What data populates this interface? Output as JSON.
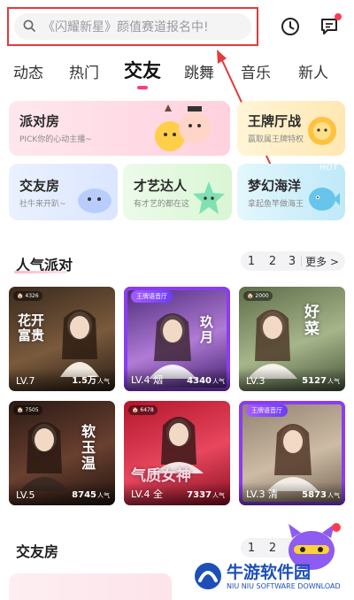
{
  "search": {
    "placeholder": "《闪耀新星》颜值赛道报名中!"
  },
  "top_icons": {
    "history": "clock-icon",
    "messages": "message-icon"
  },
  "tabs": [
    {
      "label": "动态"
    },
    {
      "label": "热门"
    },
    {
      "label": "交友",
      "active": true
    },
    {
      "label": "跳舞"
    },
    {
      "label": "音乐"
    },
    {
      "label": "新人"
    }
  ],
  "feature_cards": [
    {
      "title": "派对房",
      "subtitle": "PICK你的心动主播~"
    },
    {
      "title": "王牌厅战",
      "subtitle": "赢取属王牌特权"
    },
    {
      "title": "交友房",
      "subtitle": "社牛来开趴~"
    },
    {
      "title": "才艺达人",
      "subtitle": "有才艺的都在这"
    },
    {
      "title": "梦幻海洋",
      "subtitle": "拿起鱼竿做海王",
      "badge": "HOT"
    }
  ],
  "popular": {
    "title": "人气派对",
    "pager": [
      "1",
      "2",
      "3"
    ],
    "more": "更多 >",
    "rooms": [
      {
        "badge": "🏠 4326",
        "level": "LV.7",
        "count": "1.5万",
        "count_suffix": "人气",
        "deco": "花开富贵"
      },
      {
        "king": "王牌语音厅",
        "level": "LV.4 烟",
        "count": "4340",
        "count_suffix": "人气",
        "deco": "玖月"
      },
      {
        "badge": "🏠 2000",
        "level": "LV.3",
        "count": "5127",
        "count_suffix": "人气",
        "deco": "好菜"
      },
      {
        "badge": "🏠 7505",
        "level": "LV.5",
        "count": "8745",
        "count_suffix": "人气",
        "deco": "软玉温"
      },
      {
        "badge": "🏠 6478",
        "level": "LV.4 全",
        "count": "7337",
        "count_suffix": "人气",
        "deco": "气质女神"
      },
      {
        "king": "王牌语音厅",
        "level": "LV.3 清",
        "count": "5873",
        "count_suffix": "人气",
        "deco": ""
      }
    ]
  },
  "friends": {
    "title": "交友房",
    "pager": [
      "1",
      "2"
    ]
  },
  "watermark": {
    "title": "牛游软件园",
    "subtitle": "NIU NIU SOFTWARE DOWNLOAD"
  }
}
